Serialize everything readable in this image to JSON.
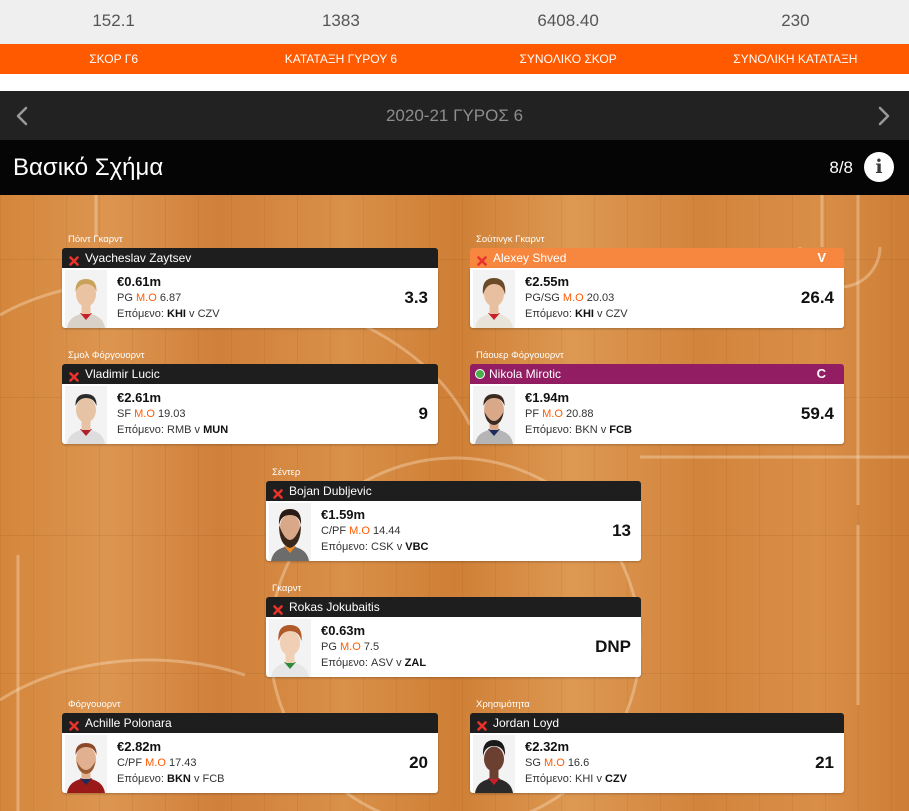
{
  "theme": {
    "accent": "#ff5a00",
    "captain": "#931d63",
    "vice_captain": "#f7873f",
    "header_dark": "#1e1e1e",
    "remove": "#e8322b",
    "active": "#49b04b"
  },
  "stats": [
    {
      "value": "152.1",
      "label": "ΣΚΟΡ Γ6"
    },
    {
      "value": "1383",
      "label": "ΚΑΤΑΤΑΞΗ ΓΥΡΟΥ 6"
    },
    {
      "value": "6408.40",
      "label": "ΣΥΝΟΛΙΚΟ ΣΚΟΡ"
    },
    {
      "value": "230",
      "label": "ΣΥΝΟΛΙΚΗ ΚΑΤΑΤΑΞΗ"
    }
  ],
  "round_nav": {
    "title": "2020-21 ΓΥΡΟΣ 6",
    "prev_icon": "chevron-left-icon",
    "next_icon": "chevron-right-icon"
  },
  "lineup_header": {
    "title": "Βασικό Σχήμα",
    "count": "8/8",
    "info_icon": "info-icon",
    "info_glyph": "i"
  },
  "labels": {
    "avg": "Μ.Ο",
    "next": "Επόμενο:",
    "vs": "v"
  },
  "lineup": [
    {
      "position": "Πόιντ Γκαρντ",
      "name": "Vyacheslav Zaytsev",
      "icon": "remove-icon",
      "price": "€0.61m",
      "role": "PG",
      "avg": "6.87",
      "next_home": "KHI",
      "next_away": "CZV",
      "score": "3.3"
    },
    {
      "position": "Σούτινγκ Γκαρντ",
      "name": "Alexey Shved",
      "icon": "remove-icon",
      "badge": "V",
      "price": "€2.55m",
      "role": "PG/SG",
      "avg": "20.03",
      "next_home": "KHI",
      "next_away": "CZV",
      "score": "26.4"
    },
    {
      "position": "Σμολ Φόργουορντ",
      "name": "Vladimir Lucic",
      "icon": "remove-icon",
      "price": "€2.61m",
      "role": "SF",
      "avg": "19.03",
      "next_home": "RMB",
      "next_away": "MUN",
      "score": "9"
    },
    {
      "position": "Πάουερ Φόργουορντ",
      "name": "Nikola Mirotic",
      "icon": "active-dot-icon",
      "badge": "C",
      "price": "€1.94m",
      "role": "PF",
      "avg": "20.88",
      "next_home": "BKN",
      "next_away": "FCB",
      "score": "59.4"
    },
    {
      "position": "Σέντερ",
      "name": "Bojan Dubljevic",
      "icon": "remove-icon",
      "price": "€1.59m",
      "role": "C/PF",
      "avg": "14.44",
      "next_home": "CSK",
      "next_away": "VBC",
      "score": "13"
    },
    {
      "position": "Γκαρντ",
      "name": "Rokas Jokubaitis",
      "icon": "remove-icon",
      "price": "€0.63m",
      "role": "PG",
      "avg": "7.5",
      "next_home": "ASV",
      "next_away": "ZAL",
      "score": "DNP"
    },
    {
      "position": "Φόργουορντ",
      "name": "Achille Polonara",
      "icon": "remove-icon",
      "price": "€2.82m",
      "role": "C/PF",
      "avg": "17.43",
      "next_home": "BKN",
      "next_away": "FCB",
      "score": "20"
    },
    {
      "position": "Χρησιμότητα",
      "name": "Jordan Loyd",
      "icon": "remove-icon",
      "price": "€2.32m",
      "role": "SG",
      "avg": "16.6",
      "next_home": "KHI",
      "next_away": "CZV",
      "score": "21"
    }
  ]
}
